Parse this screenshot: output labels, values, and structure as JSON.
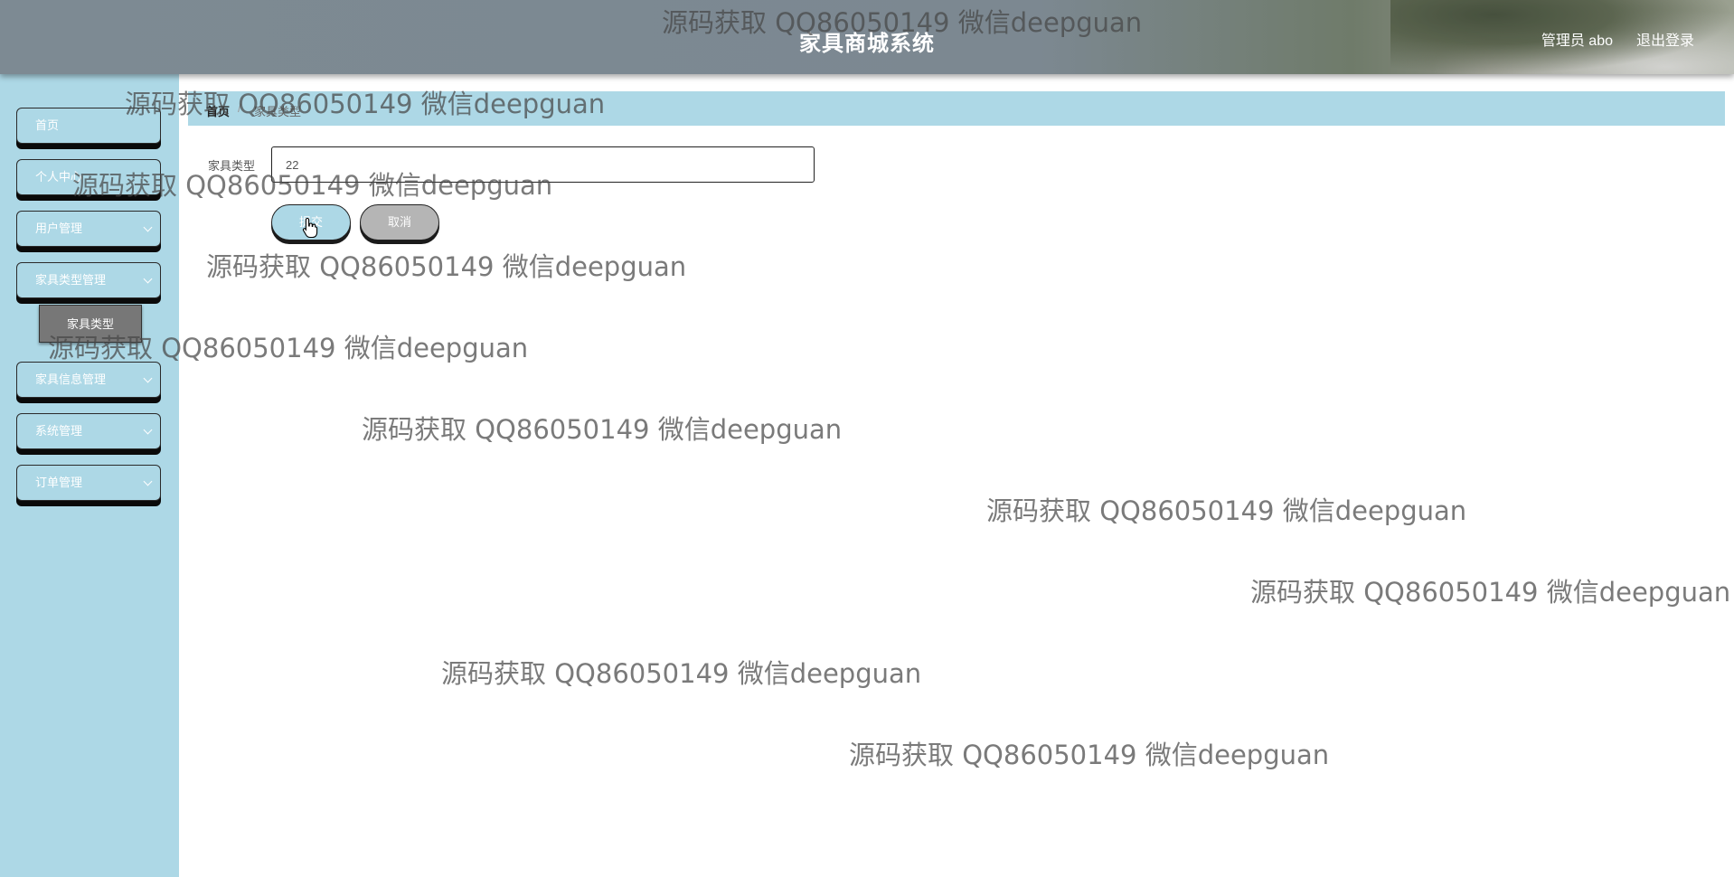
{
  "header": {
    "title": "家具商城系统",
    "user_label": "管理员 abo",
    "logout_label": "退出登录"
  },
  "sidebar": {
    "items": [
      {
        "label": "首页"
      },
      {
        "label": "个人中心"
      },
      {
        "label": "用户管理"
      },
      {
        "label": "家具类型管理"
      },
      {
        "label": "家具信息管理"
      },
      {
        "label": "系统管理"
      },
      {
        "label": "订单管理"
      }
    ],
    "active_submenu": {
      "label": "家具类型"
    }
  },
  "breadcrumb": {
    "home": "首页",
    "separator": "/",
    "current": "家具类型"
  },
  "form": {
    "field_label": "家具类型",
    "field_value": "22",
    "submit_label": "提交",
    "cancel_label": "取消"
  },
  "watermark": {
    "text": "源码获取 QQ86050149 微信deepguan"
  },
  "colors": {
    "accent": "#add8e6",
    "header": "#7c8891",
    "submenu": "#777777",
    "cancel": "#b5b5b5"
  }
}
